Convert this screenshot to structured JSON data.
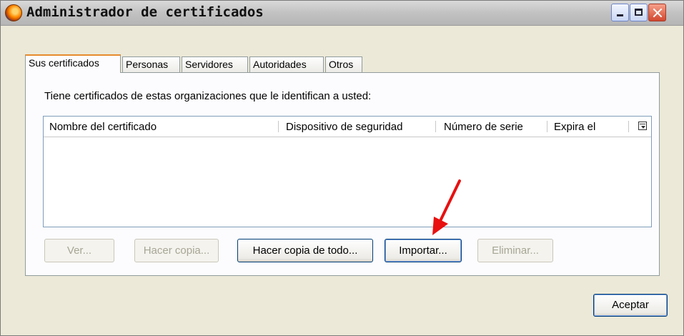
{
  "window": {
    "title": "Administrador de certificados"
  },
  "tabs": [
    {
      "label": "Sus certificados",
      "active": true
    },
    {
      "label": "Personas",
      "active": false
    },
    {
      "label": "Servidores",
      "active": false
    },
    {
      "label": "Autoridades",
      "active": false
    },
    {
      "label": "Otros",
      "active": false
    }
  ],
  "panel": {
    "description": "Tiene certificados de estas organizaciones que le identifican a usted:",
    "columns": [
      "Nombre del certificado",
      "Dispositivo de seguridad",
      "Número de serie",
      "Expira el"
    ],
    "rows": []
  },
  "buttons": {
    "view": "Ver...",
    "backup": "Hacer copia...",
    "backup_all": "Hacer copia de todo...",
    "import": "Importar...",
    "delete": "Eliminar...",
    "ok": "Aceptar"
  },
  "colors": {
    "annotation_arrow": "#e81010",
    "active_tab_accent": "#e68b2c"
  },
  "icons": [
    "app-icon",
    "minimize-icon",
    "maximize-icon",
    "close-icon",
    "column-picker-icon",
    "annotation-arrow"
  ]
}
